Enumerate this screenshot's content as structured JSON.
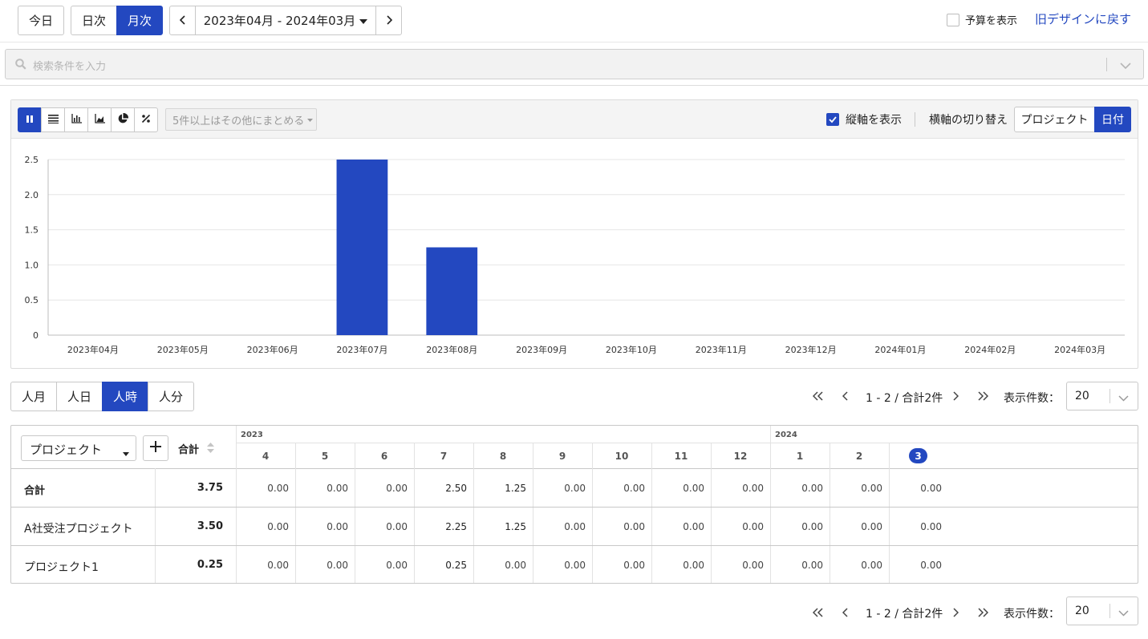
{
  "toolbar": {
    "today": "今日",
    "daily": "日次",
    "monthly": "月次",
    "range": "2023年04月 - 2024年03月",
    "show_budget": "予算を表示",
    "old_design": "旧デザインに戻す"
  },
  "search": {
    "placeholder": "検索条件を入力"
  },
  "chart_panel": {
    "group_dropdown": "5件以上はその他にまとめる",
    "show_y_axis": "縦軸を表示",
    "x_axis_switch_label": "横軸の切り替え",
    "x_axis_options": [
      "プロジェクト",
      "日付"
    ],
    "x_axis_selected": "日付",
    "view_icons": [
      "bar-chart-icon",
      "list-icon",
      "column-chart-icon",
      "area-chart-icon",
      "pie-chart-icon",
      "percent-icon"
    ]
  },
  "chart_data": {
    "type": "bar",
    "categories": [
      "2023年04月",
      "2023年05月",
      "2023年06月",
      "2023年07月",
      "2023年08月",
      "2023年09月",
      "2023年10月",
      "2023年11月",
      "2023年12月",
      "2024年01月",
      "2024年02月",
      "2024年03月"
    ],
    "values": [
      0,
      0,
      0,
      2.5,
      1.25,
      0,
      0,
      0,
      0,
      0,
      0,
      0
    ],
    "yticks": [
      "0",
      "0.5",
      "1.0",
      "1.5",
      "2.0",
      "2.5"
    ],
    "ylim": [
      0,
      2.5
    ],
    "color": "#2348c0",
    "grid": true
  },
  "units": {
    "items": [
      "人月",
      "人日",
      "人時",
      "人分"
    ],
    "selected": "人時"
  },
  "pager": {
    "summary": "1 - 2 / 合計2件",
    "per_page_label": "表示件数：",
    "per_page": "20"
  },
  "table": {
    "group_select": "プロジェクト",
    "add": "+",
    "total_header": "合計",
    "years": [
      {
        "label": "2023"
      },
      {
        "label": "2024"
      }
    ],
    "months": [
      "4",
      "5",
      "6",
      "7",
      "8",
      "9",
      "10",
      "11",
      "12",
      "1",
      "2",
      "3"
    ],
    "current_month": "3",
    "rows": [
      {
        "label": "合計",
        "total": "3.75",
        "values": [
          "0.00",
          "0.00",
          "0.00",
          "2.50",
          "1.25",
          "0.00",
          "0.00",
          "0.00",
          "0.00",
          "0.00",
          "0.00",
          "0.00"
        ],
        "bold": true
      },
      {
        "label": "A社受注プロジェクト",
        "total": "3.50",
        "values": [
          "0.00",
          "0.00",
          "0.00",
          "2.25",
          "1.25",
          "0.00",
          "0.00",
          "0.00",
          "0.00",
          "0.00",
          "0.00",
          "0.00"
        ]
      },
      {
        "label": "プロジェクト1",
        "total": "0.25",
        "values": [
          "0.00",
          "0.00",
          "0.00",
          "0.25",
          "0.00",
          "0.00",
          "0.00",
          "0.00",
          "0.00",
          "0.00",
          "0.00",
          "0.00"
        ]
      }
    ]
  }
}
